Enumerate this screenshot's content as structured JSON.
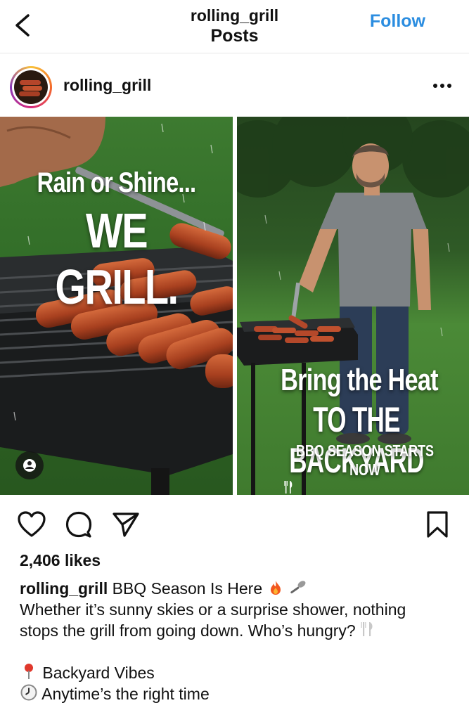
{
  "nav": {
    "username": "rolling_grill",
    "subtitle": "Posts",
    "follow_label": "Follow",
    "back_icon": "chevron-left-icon"
  },
  "post": {
    "username": "rolling_grill",
    "more_icon": "ellipsis-icon"
  },
  "carousel": {
    "slide1": {
      "line1": "Rain or Shine...",
      "line2": "WE GRILL."
    },
    "slide2": {
      "line1": "Bring the Heat",
      "line2": "TO THE BACKYARD",
      "line3": "BBQ SEASON STARTS NOW"
    }
  },
  "actions": {
    "like_icon": "heart-icon",
    "comment_icon": "comment-icon",
    "share_icon": "send-icon",
    "save_icon": "bookmark-icon"
  },
  "engagement": {
    "likes": "2,406 likes"
  },
  "caption": {
    "username": "rolling_grill",
    "headline": "BBQ Season Is Here",
    "body_line1": "Whether it’s sunny skies or a surprise shower, nothing",
    "body_line2": "stops the grill from going down. Who’s hungry?",
    "bullet1": "Backyard Vibes",
    "bullet2": "Anytime’s the right time"
  },
  "colors": {
    "follow_blue": "#2b8de0",
    "grass_green": "#3f7a2e"
  }
}
